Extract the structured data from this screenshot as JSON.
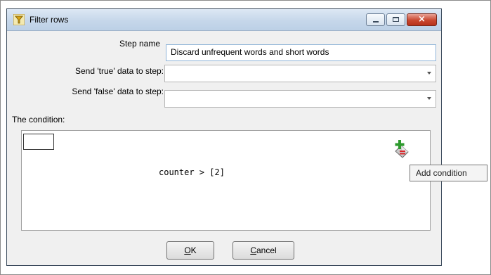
{
  "window": {
    "title": "Filter rows",
    "controls": {
      "minimize": "minimize",
      "maximize": "maximize",
      "close": "×"
    }
  },
  "form": {
    "step_name_label": "Step name",
    "step_name_value": "Discard unfrequent words and short words",
    "true_label": "Send 'true' data to step:",
    "true_value": "",
    "false_label": "Send 'false' data to step:",
    "false_value": "",
    "condition_label": "The condition:"
  },
  "condition": {
    "expression": "counter > [2]"
  },
  "buttons": {
    "ok_mnemonic": "O",
    "ok_rest": "K",
    "cancel_mnemonic": "C",
    "cancel_rest": "ancel"
  },
  "tooltip": {
    "text": "Add condition"
  },
  "icons": {
    "app": "filter-funnel-icon",
    "add_condition": "add-condition-icon"
  },
  "colors": {
    "title_bar": "#c6d7ea",
    "close_button": "#c9472f",
    "add_plus": "#2e9a2e",
    "remove_minus": "#d9262b"
  }
}
